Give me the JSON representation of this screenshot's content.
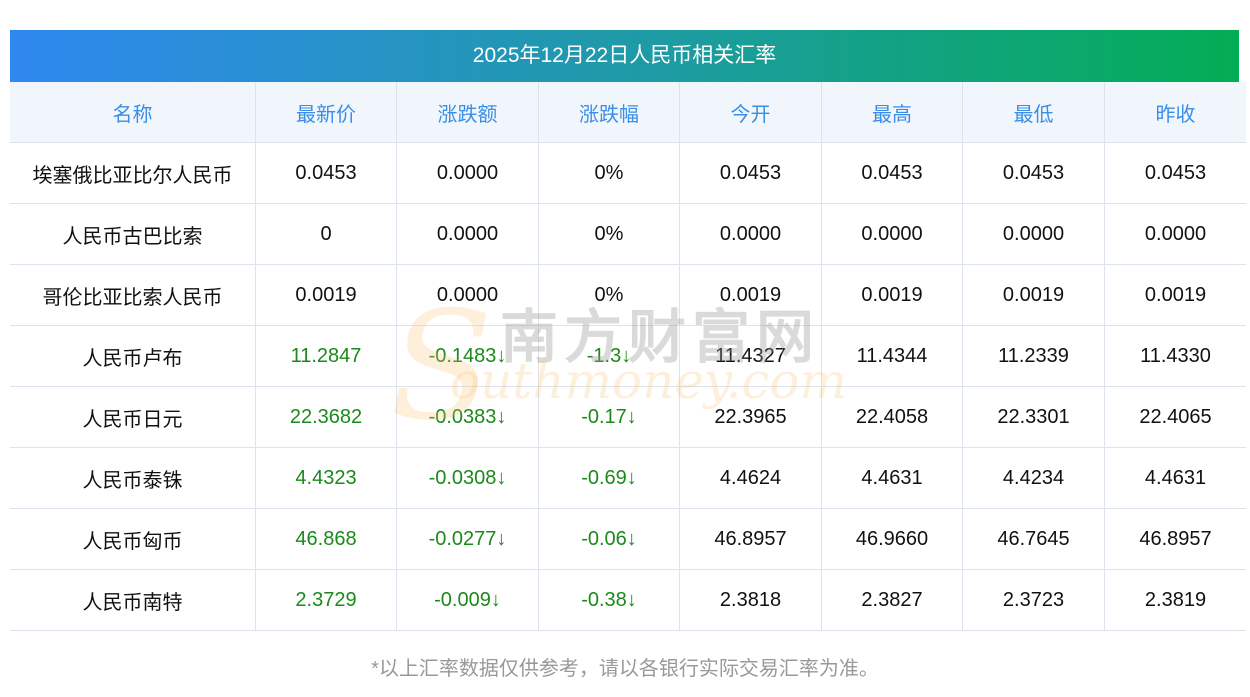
{
  "title": "2025年12月22日人民币相关汇率",
  "columns": [
    "名称",
    "最新价",
    "涨跌额",
    "涨跌幅",
    "今开",
    "最高",
    "最低",
    "昨收"
  ],
  "rows": [
    [
      "埃塞俄比亚比尔人民币",
      "0.0453",
      "0.0000",
      "0%",
      "0.0453",
      "0.0453",
      "0.0453",
      "0.0453"
    ],
    [
      "人民币古巴比索",
      "0",
      "0.0000",
      "0%",
      "0.0000",
      "0.0000",
      "0.0000",
      "0.0000"
    ],
    [
      "哥伦比亚比索人民币",
      "0.0019",
      "0.0000",
      "0%",
      "0.0019",
      "0.0019",
      "0.0019",
      "0.0019"
    ],
    [
      "人民币卢布",
      "11.2847",
      "-0.1483↓",
      "-1.3↓",
      "11.4327",
      "11.4344",
      "11.2339",
      "11.4330"
    ],
    [
      "人民币日元",
      "22.3682",
      "-0.0383↓",
      "-0.17↓",
      "22.3965",
      "22.4058",
      "22.3301",
      "22.4065"
    ],
    [
      "人民币泰铢",
      "4.4323",
      "-0.0308↓",
      "-0.69↓",
      "4.4624",
      "4.4631",
      "4.4234",
      "4.4631"
    ],
    [
      "人民币匈币",
      "46.868",
      "-0.0277↓",
      "-0.06↓",
      "46.8957",
      "46.9660",
      "46.7645",
      "46.8957"
    ],
    [
      "人民币南特",
      "2.3729",
      "-0.009↓",
      "-0.38↓",
      "2.3818",
      "2.3827",
      "2.3723",
      "2.3819"
    ]
  ],
  "down_rows": [
    3,
    4,
    5,
    6,
    7
  ],
  "watermark": {
    "cn": "南方财富网",
    "en": "outhmoney.com",
    "s": "S"
  },
  "footer": "*以上汇率数据仅供参考，请以各银行实际交易汇率为准。"
}
